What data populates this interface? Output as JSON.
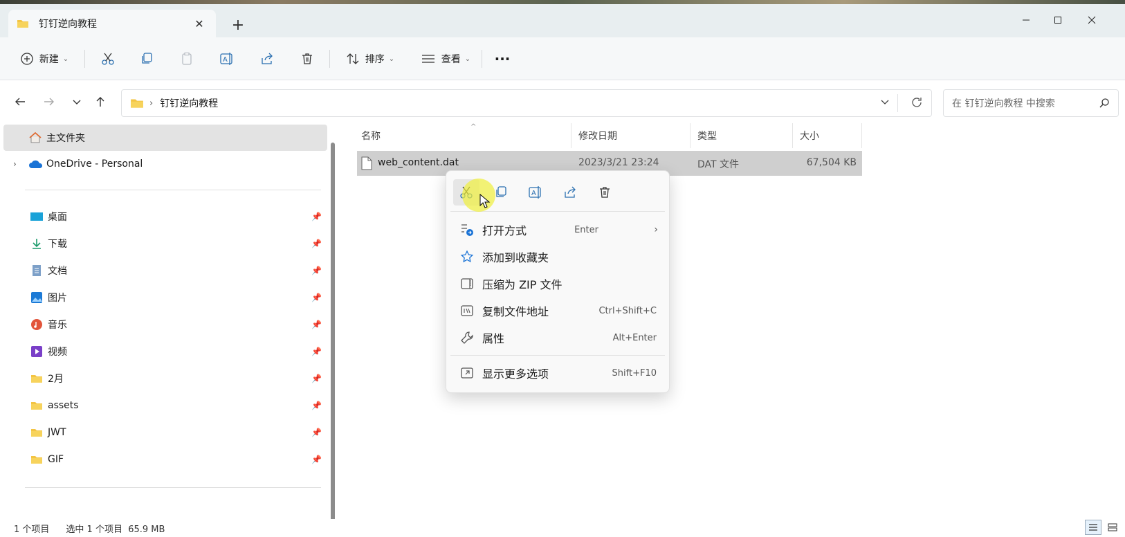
{
  "window": {
    "tab_title": "钉钉逆向教程",
    "tab_close_icon": "close-icon",
    "new_tab_icon": "plus-icon"
  },
  "toolbar": {
    "new_label": "新建",
    "sort_label": "排序",
    "view_label": "查看",
    "more_icon": "more-icon"
  },
  "address": {
    "breadcrumb": "钉钉逆向教程",
    "search_placeholder": "在 钉钉逆向教程 中搜索"
  },
  "sidebar": {
    "home": "主文件夹",
    "onedrive": "OneDrive - Personal",
    "pinned": [
      {
        "label": "桌面",
        "icon": "desktop-icon"
      },
      {
        "label": "下载",
        "icon": "download-icon"
      },
      {
        "label": "文档",
        "icon": "document-icon"
      },
      {
        "label": "图片",
        "icon": "pictures-icon"
      },
      {
        "label": "音乐",
        "icon": "music-icon"
      },
      {
        "label": "视频",
        "icon": "video-icon"
      },
      {
        "label": "2月",
        "icon": "folder-icon"
      },
      {
        "label": "assets",
        "icon": "folder-icon"
      },
      {
        "label": "JWT",
        "icon": "folder-icon"
      },
      {
        "label": "GIF",
        "icon": "folder-icon"
      }
    ]
  },
  "columns": {
    "name": "名称",
    "modified": "修改日期",
    "type": "类型",
    "size": "大小"
  },
  "files": [
    {
      "name": "web_content.dat",
      "modified": "2023/3/21 23:24",
      "type": "DAT 文件",
      "size": "67,504 KB"
    }
  ],
  "context_menu": {
    "items": [
      {
        "label": "打开方式",
        "shortcut": "Enter",
        "icon": "open-with-icon"
      },
      {
        "label": "添加到收藏夹",
        "shortcut": "",
        "icon": "star-icon"
      },
      {
        "label": "压缩为 ZIP 文件",
        "shortcut": "",
        "icon": "zip-icon"
      },
      {
        "label": "复制文件地址",
        "shortcut": "Ctrl+Shift+C",
        "icon": "copy-path-icon"
      },
      {
        "label": "属性",
        "shortcut": "Alt+Enter",
        "icon": "wrench-icon"
      },
      {
        "label": "显示更多选项",
        "shortcut": "Shift+F10",
        "icon": "more-options-icon"
      }
    ]
  },
  "status": {
    "count": "1 个项目",
    "selection": "选中 1 个项目  65.9 MB"
  },
  "colors": {
    "accent": "#0067c0",
    "folder_yellow": "#f3c443",
    "selected_row": "#cfcfcf"
  }
}
